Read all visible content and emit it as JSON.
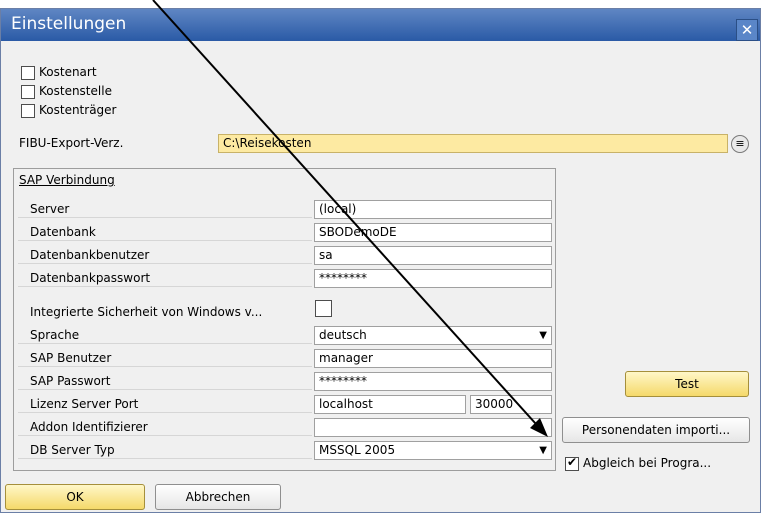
{
  "window": {
    "title": "Einstellungen",
    "close_glyph": "✕"
  },
  "checks": [
    {
      "label": "Kostenart",
      "checked": false
    },
    {
      "label": "Kostenstelle",
      "checked": false
    },
    {
      "label": "Kostenträger",
      "checked": false
    }
  ],
  "fibu": {
    "label": "FIBU-Export-Verz.",
    "value": "C:\\Reisekosten",
    "browse_icon": "browse-icon"
  },
  "sap": {
    "group_title": "SAP Verbindung",
    "rows": {
      "server": {
        "label": "Server",
        "value": "(local)"
      },
      "datenbank": {
        "label": "Datenbank",
        "value": "SBODemoDE"
      },
      "benutzer": {
        "label": "Datenbankbenutzer",
        "value": "sa"
      },
      "passwort": {
        "label": "Datenbankpasswort",
        "value": "********"
      },
      "integriert": {
        "label": "Integrierte Sicherheit von Windows v...",
        "checked": false
      },
      "sprache": {
        "label": "Sprache",
        "value": "deutsch"
      },
      "sap_benutzer": {
        "label": "SAP Benutzer",
        "value": "manager"
      },
      "sap_passwort": {
        "label": "SAP Passwort",
        "value": "********"
      },
      "lizenz": {
        "label": "Lizenz Server Port",
        "host": "localhost",
        "port": "30000"
      },
      "addon": {
        "label": "Addon Identifizierer",
        "value": ""
      },
      "dbtyp": {
        "label": "DB Server Typ",
        "value": "MSSQL 2005"
      }
    }
  },
  "buttons": {
    "test": "Test",
    "personendaten": "Personendaten importi...",
    "ok": "OK",
    "abbrechen": "Abbrechen"
  },
  "abgleich": {
    "label": "Abgleich bei Progra...",
    "checked": true
  }
}
